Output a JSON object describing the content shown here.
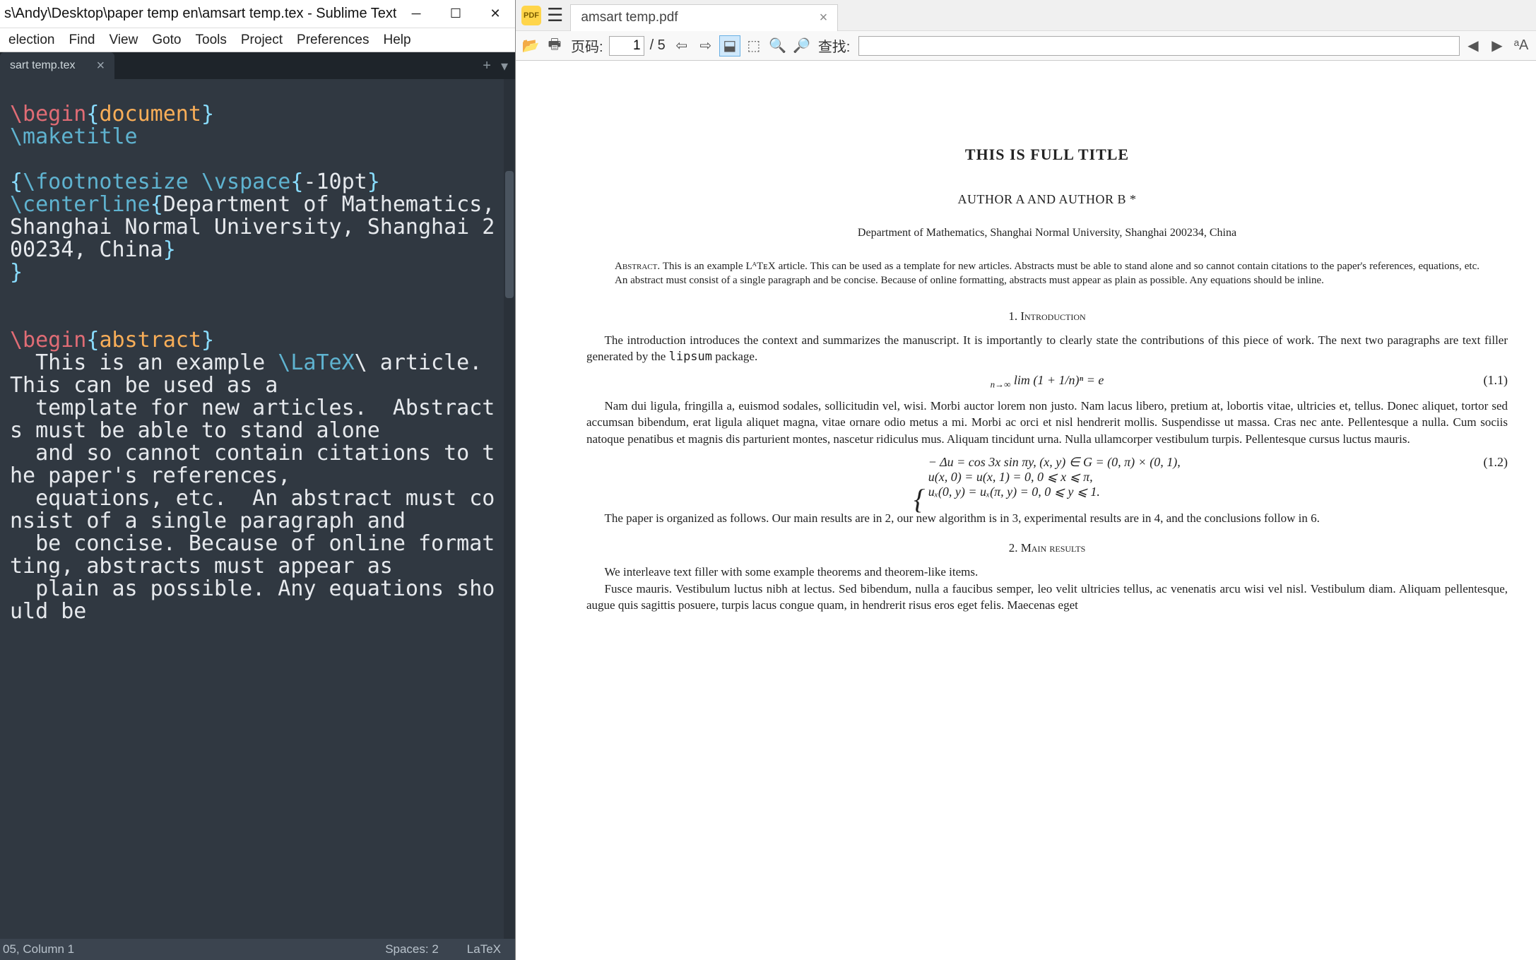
{
  "sublime": {
    "title": "s\\Andy\\Desktop\\paper temp en\\amsart temp.tex - Sublime Text",
    "menu": [
      "election",
      "Find",
      "View",
      "Goto",
      "Tools",
      "Project",
      "Preferences",
      "Help"
    ],
    "tab": {
      "label": "sart temp.tex"
    },
    "status": {
      "pos": "05, Column 1",
      "spaces": "Spaces: 2",
      "syntax": "LaTeX"
    },
    "code": {
      "l1_cmd": "\\begin",
      "l1_env": "document",
      "l2_cmd": "\\maketitle",
      "l3_cmd1": "\\footnotesize",
      "l3_cmd2": "\\vspace",
      "l3_arg": "-10pt",
      "l4_cmd": "\\centerline",
      "l4_text": "Department of Mathematics, Shanghai Normal University, Shanghai 200234, China",
      "l5_cmd": "\\begin",
      "l5_env": "abstract",
      "l6_text1": "This is an example ",
      "l6_latex": "\\LaTeX",
      "l6_text2": "\\ article. This can be used as a",
      "l7_text": "template for new articles.  Abstracts must be able to stand alone",
      "l8_text": "and so cannot contain citations to the paper's references,",
      "l9_text": "equations, etc.  An abstract must consist of a single paragraph and",
      "l10_text": "be concise. Because of online formatting, abstracts must appear as",
      "l11_text": "plain as possible. Any equations should be"
    }
  },
  "pdf": {
    "tab": "amsart temp.pdf",
    "toolbar": {
      "page_label": "页码:",
      "page_current": "1",
      "page_total": "/ 5",
      "find_label": "查找:"
    },
    "paper": {
      "title": "THIS IS FULL TITLE",
      "authors": "AUTHOR A    AND    AUTHOR B *",
      "dept": "Department of Mathematics, Shanghai Normal University, Shanghai 200234, China",
      "abstract_label": "Abstract.",
      "abstract": " This is an example LᴬTᴇX article. This can be used as a template for new articles. Abstracts must be able to stand alone and so cannot contain citations to the paper's references, equations, etc. An abstract must consist of a single paragraph and be concise. Because of online formatting, abstracts must appear as plain as possible. Any equations should be inline.",
      "sec1": "1.  Introduction",
      "intro1": "The introduction introduces the context and summarizes the manuscript.  It is importantly to clearly state the contributions of this piece of work.  The next two paragraphs are text filler generated by the ",
      "intro1_code": "lipsum",
      "intro1b": " package.",
      "eq1": "lim (1 + 1/n)ⁿ = e",
      "eq1_sub": "n→∞",
      "eq1_num": "(1.1)",
      "intro2": "Nam dui ligula, fringilla a, euismod sodales, sollicitudin vel, wisi.  Morbi auctor lorem non justo. Nam lacus libero, pretium at, lobortis vitae, ultricies et, tellus. Donec aliquet, tortor sed accumsan bibendum, erat ligula aliquet magna, vitae ornare odio metus a mi. Morbi ac orci et nisl hendrerit mollis. Suspendisse ut massa. Cras nec ante. Pellentesque a nulla. Cum sociis natoque penatibus et magnis dis parturient montes, nascetur ridiculus mus. Aliquam tincidunt urna. Nulla ullamcorper vestibulum turpis. Pellentesque cursus luctus mauris.",
      "eq2_l1": "− Δu = cos 3x sin πy,     (x, y) ∈ G = (0, π) × (0, 1),",
      "eq2_l2": "u(x, 0) = u(x, 1) = 0,       0 ⩽ x ⩽ π,",
      "eq2_l3": "uₓ(0, y) = uₓ(π, y) = 0,   0 ⩽ y ⩽ 1.",
      "eq2_num": "(1.2)",
      "intro3": "The paper is organized as follows.  Our main results are in 2, our new algorithm is in 3, experimental results are in 4, and the conclusions follow in 6.",
      "sec2": "2.  Main results",
      "main1": "We interleave text filler with some example theorems and theorem-like items.",
      "main2": "Fusce mauris.  Vestibulum luctus nibh at lectus.  Sed bibendum, nulla a faucibus semper, leo velit ultricies tellus, ac venenatis arcu wisi vel nisl. Vestibulum diam. Aliquam pellentesque, augue quis sagittis posuere, turpis lacus congue quam, in hendrerit risus eros eget felis.  Maecenas eget"
    }
  }
}
